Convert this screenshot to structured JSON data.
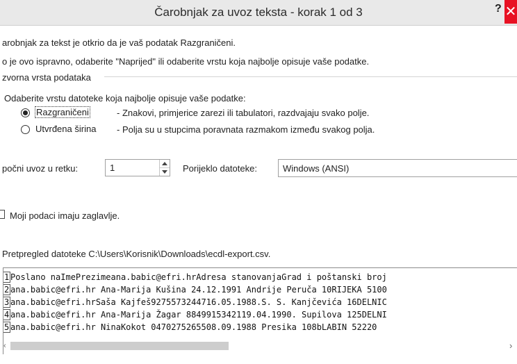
{
  "window": {
    "title": "Čarobnjak za uvoz teksta - korak 1 od 3",
    "help_label": "?",
    "close_label": "✕"
  },
  "intro": {
    "line1": "arobnjak za tekst je otkrio da je vaš podatak Razgraničeni.",
    "line2": "o je ovo ispravno, odaberite \"Naprijed\" ili odaberite vrstu koja najbolje opisuje vaše podatke."
  },
  "data_type_group": {
    "title": "zvorna vrsta podataka",
    "prompt": "Odaberite vrstu datoteke koja najbolje opisuje vaše podatke:",
    "options": [
      {
        "label": "Razgraničeni",
        "description": "- Znakovi, primjerice zarezi ili tabulatori, razdvajaju svako polje.",
        "selected": true
      },
      {
        "label": "Utvrđena širina",
        "description": "- Polja su u stupcima poravnata razmakom između svakog polja.",
        "selected": false
      }
    ]
  },
  "import_row": {
    "label": "počni uvoz u retku:",
    "value": "1"
  },
  "file_origin": {
    "label": "Porijeklo datoteke:",
    "value": "Windows (ANSI)"
  },
  "headers_checkbox": {
    "label": "Moji podaci imaju zaglavlje.",
    "checked": false
  },
  "preview": {
    "label": "Pretpregled datoteke C:\\Users\\Korisnik\\Downloads\\ecdl-export.csv.",
    "rows": [
      {
        "num": "1",
        "text": "Poslano naImePrezimeana.babic@efri.hrAdresa stanovanjaGrad i poštanski broj"
      },
      {
        "num": "2",
        "text": "ana.babic@efri.hr Ana-Marija  Kušina 24.12.1991 Andrije Peruča 10RIJEKA 5100"
      },
      {
        "num": "3",
        "text": "ana.babic@efri.hrSaša Kajfeš9275573244716.05.1988.S. S. Kanjčevića 16DELNIC"
      },
      {
        "num": "4",
        "text": "ana.babic@efri.hr Ana-Marija Žagar 8849915342119.04.1990. Supilova 125DELNI"
      },
      {
        "num": "5",
        "text": "ana.babic@efri.hr NinaKokot 0470275265508.09.1988 Presika 108bLABIN 52220"
      }
    ]
  },
  "colors": {
    "titlebar": "#e9e9e9",
    "close": "#e81123",
    "scroll_thumb": "#cdcdcd"
  }
}
